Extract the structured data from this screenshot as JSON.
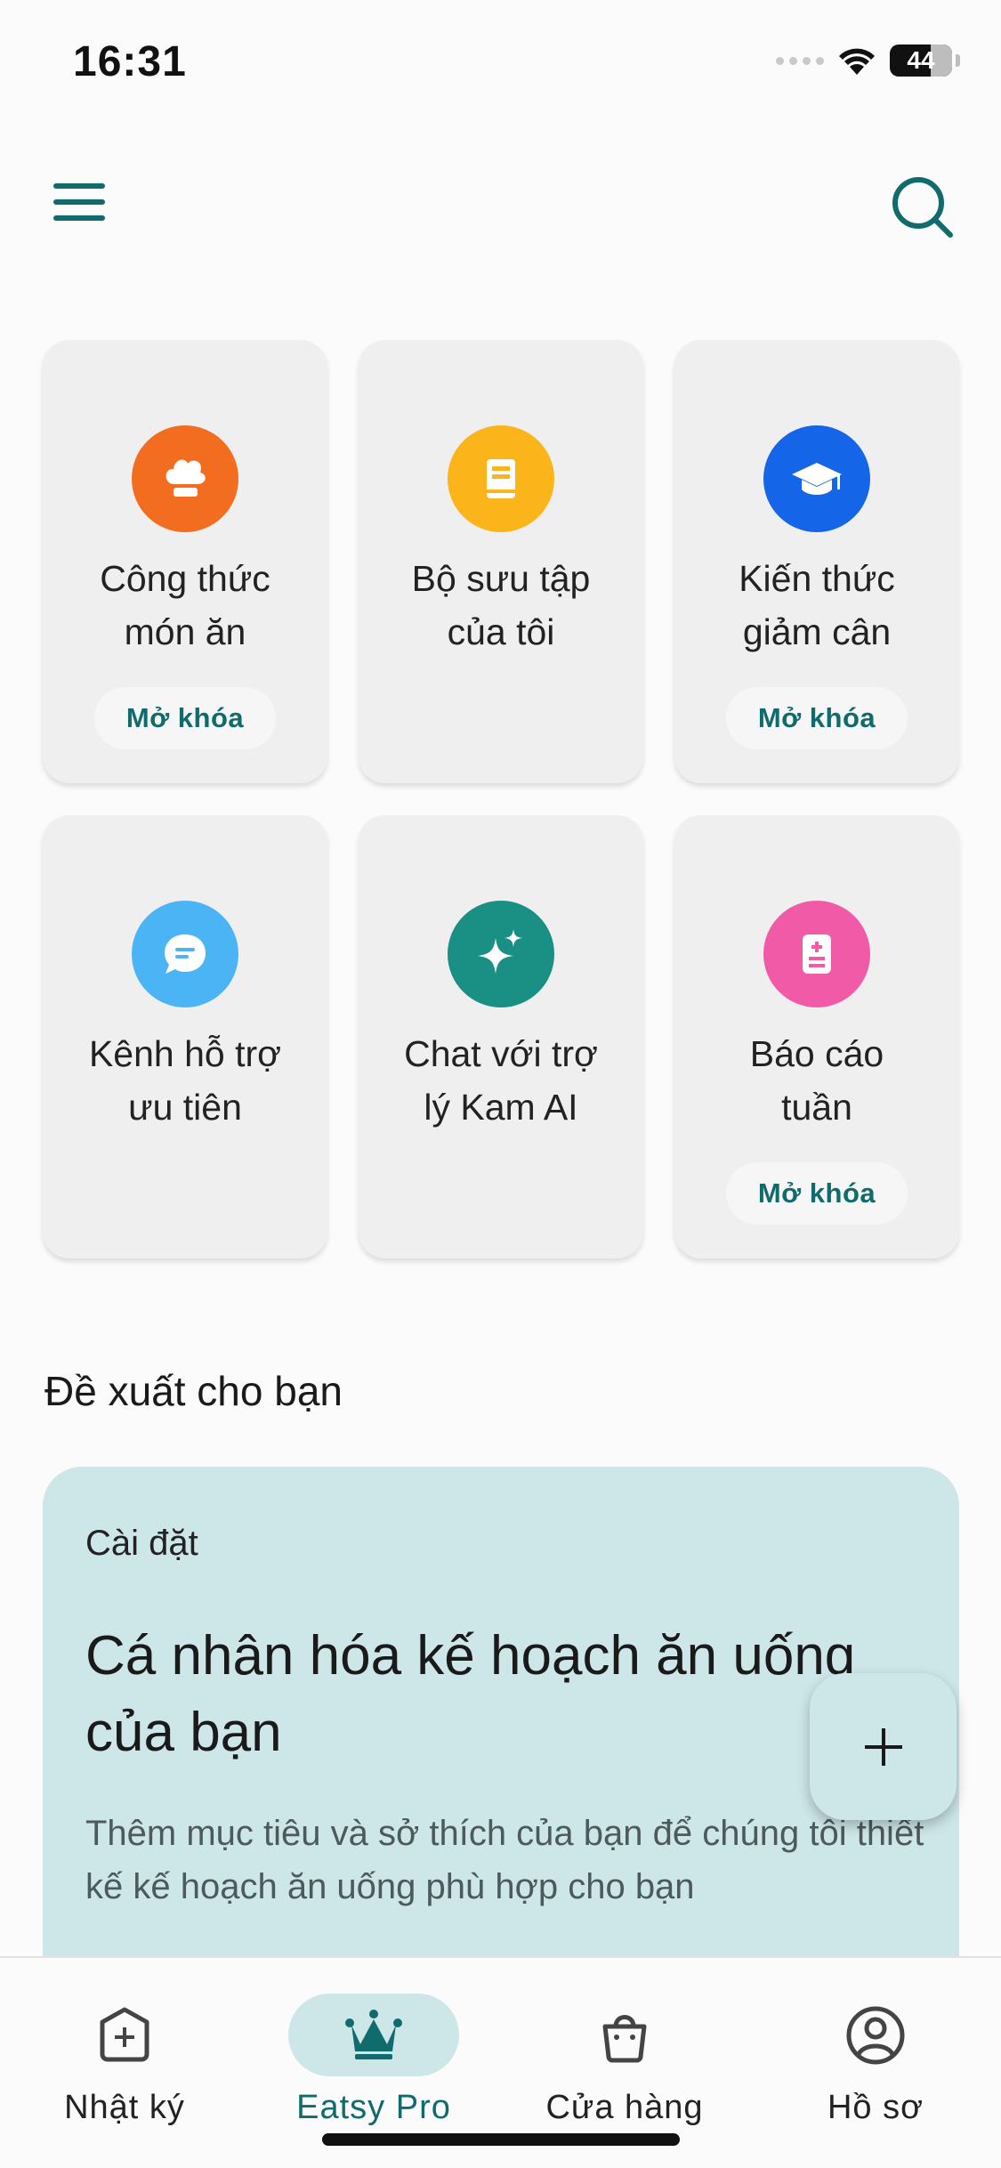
{
  "status_bar": {
    "time": "16:31",
    "battery": "44"
  },
  "features": [
    {
      "label_line1": "Công thức",
      "label_line2": "món ăn",
      "unlock": "Mở khóa",
      "icon": "chef-hat-icon",
      "color": "#f26d1f"
    },
    {
      "label_line1": "Bộ sưu tập",
      "label_line2": "của tôi",
      "unlock": "",
      "icon": "bookmark-collection-icon",
      "color": "#fbb41a"
    },
    {
      "label_line1": "Kiến thức",
      "label_line2": "giảm cân",
      "unlock": "Mở khóa",
      "icon": "graduation-cap-icon",
      "color": "#1565e8"
    },
    {
      "label_line1": "Kênh hỗ trợ",
      "label_line2": "ưu tiên",
      "unlock": "",
      "icon": "chat-bubble-icon",
      "color": "#4bb4f5"
    },
    {
      "label_line1": "Chat với trợ",
      "label_line2": "lý Kam AI",
      "unlock": "",
      "icon": "sparkle-icon",
      "color": "#1a8f83"
    },
    {
      "label_line1": "Báo cáo",
      "label_line2": "tuần",
      "unlock": "Mở khóa",
      "icon": "report-icon",
      "color": "#f15aa6"
    }
  ],
  "recommendations": {
    "title": "Đề xuất cho bạn",
    "card": {
      "kicker": "Cài đặt",
      "headline": "Cá nhân hóa kế hoạch ăn uống của bạn",
      "description": "Thêm mục tiêu và sở thích của bạn để chúng tôi thiết kế kế hoạch ăn uống phù hợp cho bạn"
    }
  },
  "bottom_nav": [
    {
      "label": "Nhật ký",
      "icon": "diary-plus-icon",
      "active": false
    },
    {
      "label": "Eatsy Pro",
      "icon": "crown-icon",
      "active": true
    },
    {
      "label": "Cửa hàng",
      "icon": "shopping-bag-icon",
      "active": false
    },
    {
      "label": "Hồ sơ",
      "icon": "profile-icon",
      "active": false
    }
  ],
  "colors": {
    "accent": "#0f6b6c",
    "card_bg": "#efefef",
    "reco_bg": "#cde6e8"
  }
}
